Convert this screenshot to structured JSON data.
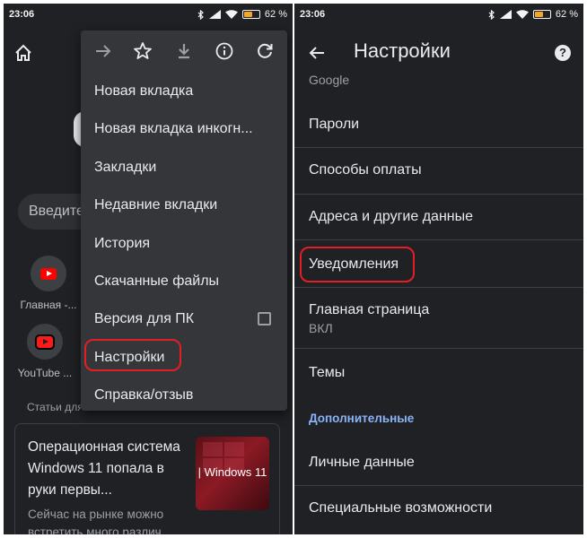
{
  "left": {
    "status": {
      "time": "23:06",
      "battery": "62 %"
    },
    "search_placeholder": "Введите",
    "shortcuts": [
      {
        "label": "Главная -..."
      },
      {
        "label": "YouTube ..."
      }
    ],
    "articles_header": "Статьи для",
    "article": {
      "title": "Операционная система Windows 11 попала в руки первы...",
      "snippet": "Сейчас на рынке можно встретить много различ",
      "thumb_text": "| Windows 11"
    },
    "menu": {
      "icons": [
        "forward-icon",
        "star-icon",
        "download-icon",
        "info-icon",
        "refresh-icon"
      ],
      "items": [
        "Новая вкладка",
        "Новая вкладка инкогн...",
        "Закладки",
        "Недавние вкладки",
        "История",
        "Скачанные файлы",
        "Версия для ПК",
        "Настройки",
        "Справка/отзыв"
      ],
      "highlighted": "Настройки"
    }
  },
  "right": {
    "status": {
      "time": "23:06",
      "battery": "62 %"
    },
    "title": "Настройки",
    "rows": {
      "google": "Google",
      "passwords": "Пароли",
      "payment": "Способы оплаты",
      "addresses": "Адреса и другие данные",
      "notifications": "Уведомления",
      "homepage": "Главная страница",
      "homepage_value": "ВКЛ",
      "themes": "Темы",
      "advanced_header": "Дополнительные",
      "privacy": "Личные данные",
      "accessibility": "Специальные возможности"
    },
    "highlighted": "Уведомления"
  },
  "colors": {
    "background": "#202124",
    "menu": "#35363a",
    "highlight": "#e31e24",
    "accent": "#8ab4f8",
    "battery": "#f5a623"
  }
}
